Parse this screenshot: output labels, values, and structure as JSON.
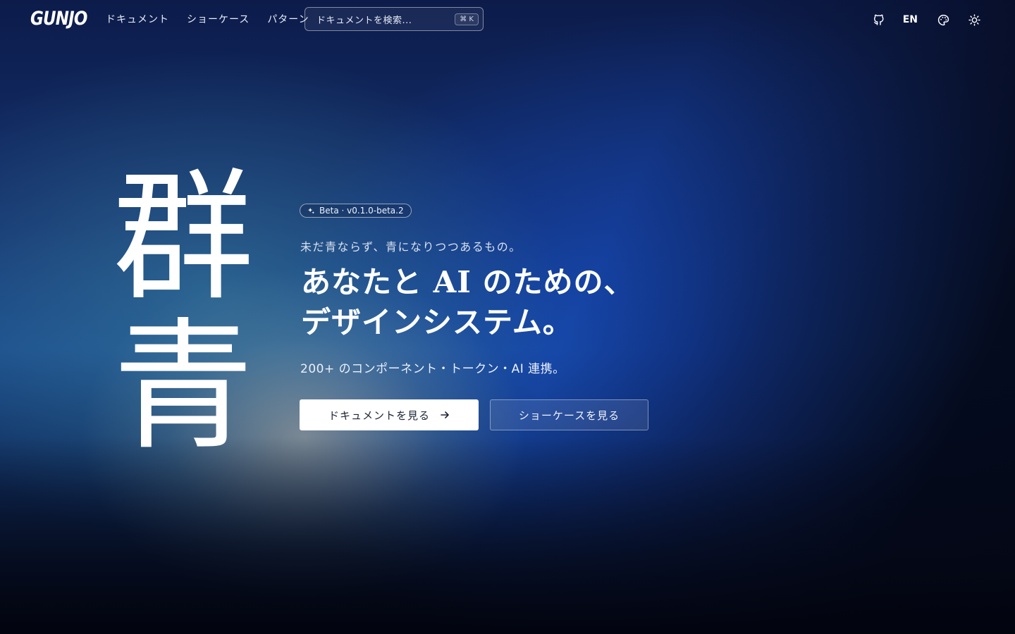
{
  "nav": {
    "logo": "GUNJO",
    "links": [
      "ドキュメント",
      "ショーケース",
      "パターン"
    ],
    "search": {
      "placeholder": "ドキュメントを検索...",
      "shortcut": "⌘ K"
    },
    "lang": "EN",
    "icons": [
      "github-icon",
      "palette-icon",
      "sun-icon"
    ]
  },
  "hero": {
    "kanji": [
      "群",
      "青"
    ],
    "badge": "Beta · v0.1.0-beta.2",
    "tagline": "未だ青ならず、青になりつつあるもの。",
    "headline_line1": "あなたと AI のための、",
    "headline_line2": "デザインシステム。",
    "subtext": "200+ のコンポーネント・トークン・AI 連携。",
    "primary_button": "ドキュメントを見る",
    "secondary_button": "ショーケースを見る"
  }
}
